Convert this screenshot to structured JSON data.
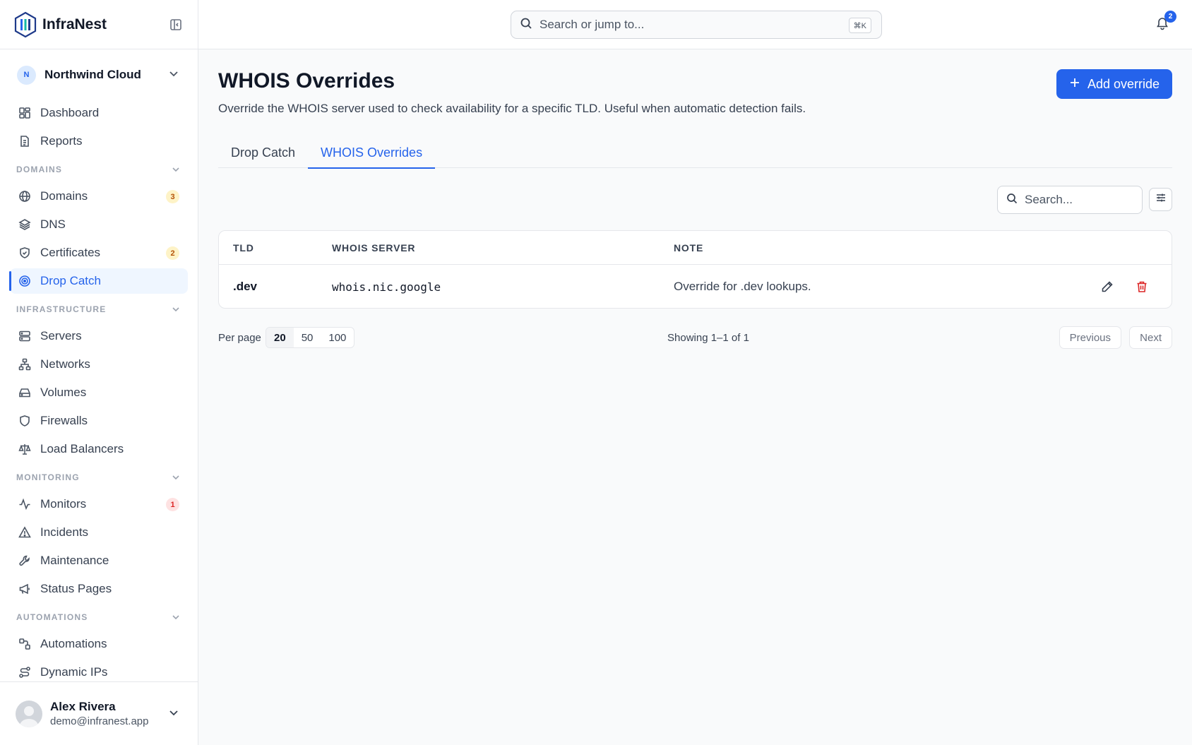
{
  "app": {
    "name": "InfraNest"
  },
  "org": {
    "initial": "N",
    "name": "Northwind Cloud"
  },
  "topbar": {
    "search_placeholder": "Search or jump to...",
    "shortcut": "⌘K",
    "notification_count": "2"
  },
  "sidebar": {
    "top_items": [
      {
        "label": "Dashboard",
        "icon": "dashboard-icon"
      },
      {
        "label": "Reports",
        "icon": "reports-icon"
      }
    ],
    "sections": [
      {
        "title": "DOMAINS",
        "items": [
          {
            "label": "Domains",
            "icon": "globe-icon",
            "badge": "3"
          },
          {
            "label": "DNS",
            "icon": "layers-icon"
          },
          {
            "label": "Certificates",
            "icon": "shield-check-icon",
            "badge": "2"
          },
          {
            "label": "Drop Catch",
            "icon": "target-icon",
            "active": true
          }
        ]
      },
      {
        "title": "INFRASTRUCTURE",
        "items": [
          {
            "label": "Servers",
            "icon": "server-icon"
          },
          {
            "label": "Networks",
            "icon": "network-icon"
          },
          {
            "label": "Volumes",
            "icon": "drive-icon"
          },
          {
            "label": "Firewalls",
            "icon": "shield-icon"
          },
          {
            "label": "Load Balancers",
            "icon": "scale-icon"
          }
        ]
      },
      {
        "title": "MONITORING",
        "items": [
          {
            "label": "Monitors",
            "icon": "activity-icon",
            "badge": "1"
          },
          {
            "label": "Incidents",
            "icon": "alert-triangle-icon"
          },
          {
            "label": "Maintenance",
            "icon": "wrench-icon"
          },
          {
            "label": "Status Pages",
            "icon": "megaphone-icon"
          }
        ]
      },
      {
        "title": "AUTOMATIONS",
        "items": [
          {
            "label": "Automations",
            "icon": "workflow-icon"
          },
          {
            "label": "Dynamic IPs",
            "icon": "route-icon"
          }
        ]
      }
    ]
  },
  "user": {
    "name": "Alex Rivera",
    "email": "demo@infranest.app"
  },
  "page": {
    "title": "WHOIS Overrides",
    "description": "Override the WHOIS server used to check availability for a specific TLD. Useful when automatic detection fails.",
    "add_label": "Add override",
    "tabs": [
      "Drop Catch",
      "WHOIS Overrides"
    ],
    "search_placeholder": "Search..."
  },
  "table": {
    "headers": [
      "TLD",
      "WHOIS SERVER",
      "NOTE"
    ],
    "rows": [
      {
        "tld": ".dev",
        "server": "whois.nic.google",
        "note": "Override for .dev lookups."
      }
    ]
  },
  "pagination": {
    "per_page_label": "Per page",
    "options": [
      "20",
      "50",
      "100"
    ],
    "selected": "20",
    "showing": "Showing 1–1 of 1",
    "previous": "Previous",
    "next": "Next"
  },
  "colors": {
    "accent": "#2563eb",
    "danger": "#dc2626",
    "warning_badge": "#b45309"
  }
}
